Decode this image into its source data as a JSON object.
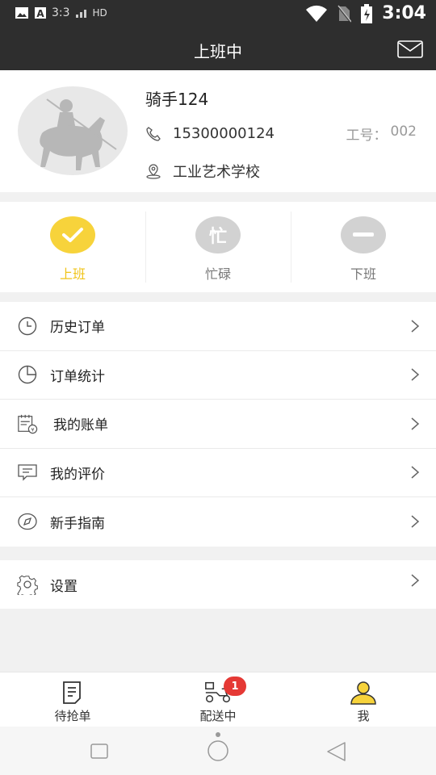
{
  "status_bar": {
    "time_left": "3:3",
    "network_label": "HD",
    "time": "3:04",
    "icons": [
      "gallery-icon",
      "a-icon",
      "signal-icon",
      "wifi-icon",
      "no-sim-icon",
      "battery-charging-icon"
    ]
  },
  "header": {
    "title": "上班中",
    "mail_icon": "mail-icon"
  },
  "profile": {
    "name": "骑手124",
    "phone": "15300000124",
    "employee_id_label": "工号：",
    "employee_id": "002",
    "school": "工业艺术学校",
    "icons": [
      "phone-icon",
      "location-icon"
    ]
  },
  "status_switch": {
    "items": [
      {
        "label": "上班",
        "icon": "check-icon",
        "glyph": "",
        "active": true
      },
      {
        "label": "忙碌",
        "icon": "busy-icon",
        "glyph": "忙",
        "active": false
      },
      {
        "label": "下班",
        "icon": "minus-icon",
        "glyph": "",
        "active": false
      }
    ]
  },
  "menu": {
    "items": [
      {
        "label": "历史订单",
        "icon": "clock-icon"
      },
      {
        "label": "订单统计",
        "icon": "pie-chart-icon"
      },
      {
        "label": "我的账单",
        "icon": "bill-icon"
      },
      {
        "label": "我的评价",
        "icon": "comment-icon"
      },
      {
        "label": "新手指南",
        "icon": "compass-icon"
      }
    ],
    "settings": {
      "label": "设置",
      "icon": "gear-icon"
    }
  },
  "tabbar": {
    "items": [
      {
        "label": "待抢单",
        "icon": "order-list-icon"
      },
      {
        "label": "配送中",
        "icon": "scooter-icon",
        "badge": "1"
      },
      {
        "label": "我",
        "icon": "user-icon"
      }
    ]
  },
  "colors": {
    "accent": "#f7d33b",
    "accent_text": "#f0c419",
    "header_bg": "#2e2e2e",
    "badge": "#e53935"
  }
}
